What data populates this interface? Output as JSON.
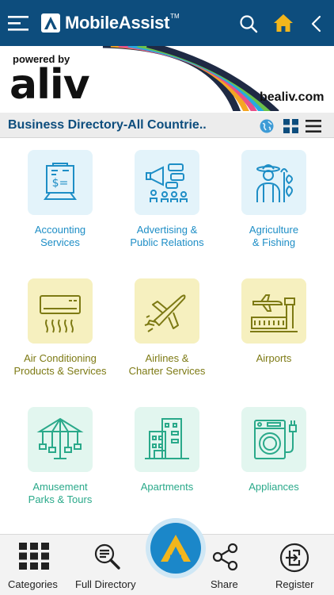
{
  "header": {
    "brand_name": "MobileAssist",
    "brand_tm": "TM",
    "icons": [
      "menu-icon",
      "search-icon",
      "home-icon",
      "back-icon"
    ],
    "colors": {
      "bar": "#0d4d7d",
      "home": "#f2b61c"
    }
  },
  "banner": {
    "powered_by": "powered by",
    "logo_text": "aliv",
    "website": "bealiv.com"
  },
  "titlebar": {
    "title": "Business Directory-All Countrie..",
    "icons": [
      "globe-icon",
      "grid-view-icon",
      "list-view-icon"
    ]
  },
  "categories": [
    {
      "line1": "Accounting",
      "line2": "Services",
      "icon": "accounting-icon",
      "theme": "blue"
    },
    {
      "line1": "Advertising &",
      "line2": "Public Relations",
      "icon": "advertising-icon",
      "theme": "blue"
    },
    {
      "line1": "Agriculture",
      "line2": "& Fishing",
      "icon": "agriculture-icon",
      "theme": "blue"
    },
    {
      "line1": "Air Conditioning",
      "line2": "Products & Services",
      "icon": "air-conditioner-icon",
      "theme": "yellow"
    },
    {
      "line1": "Airlines &",
      "line2": "Charter Services",
      "icon": "airplane-icon",
      "theme": "yellow"
    },
    {
      "line1": "Airports",
      "line2": "",
      "icon": "airport-icon",
      "theme": "yellow"
    },
    {
      "line1": "Amusement",
      "line2": "Parks & Tours",
      "icon": "carousel-icon",
      "theme": "green"
    },
    {
      "line1": "Apartments",
      "line2": "",
      "icon": "apartment-icon",
      "theme": "green"
    },
    {
      "line1": "Appliances",
      "line2": "",
      "icon": "washing-machine-icon",
      "theme": "green"
    }
  ],
  "bottom_nav": {
    "categories": "Categories",
    "full_directory": "Full Directory",
    "share": "Share",
    "register": "Register",
    "center_button_icon": "app-logo-icon"
  }
}
